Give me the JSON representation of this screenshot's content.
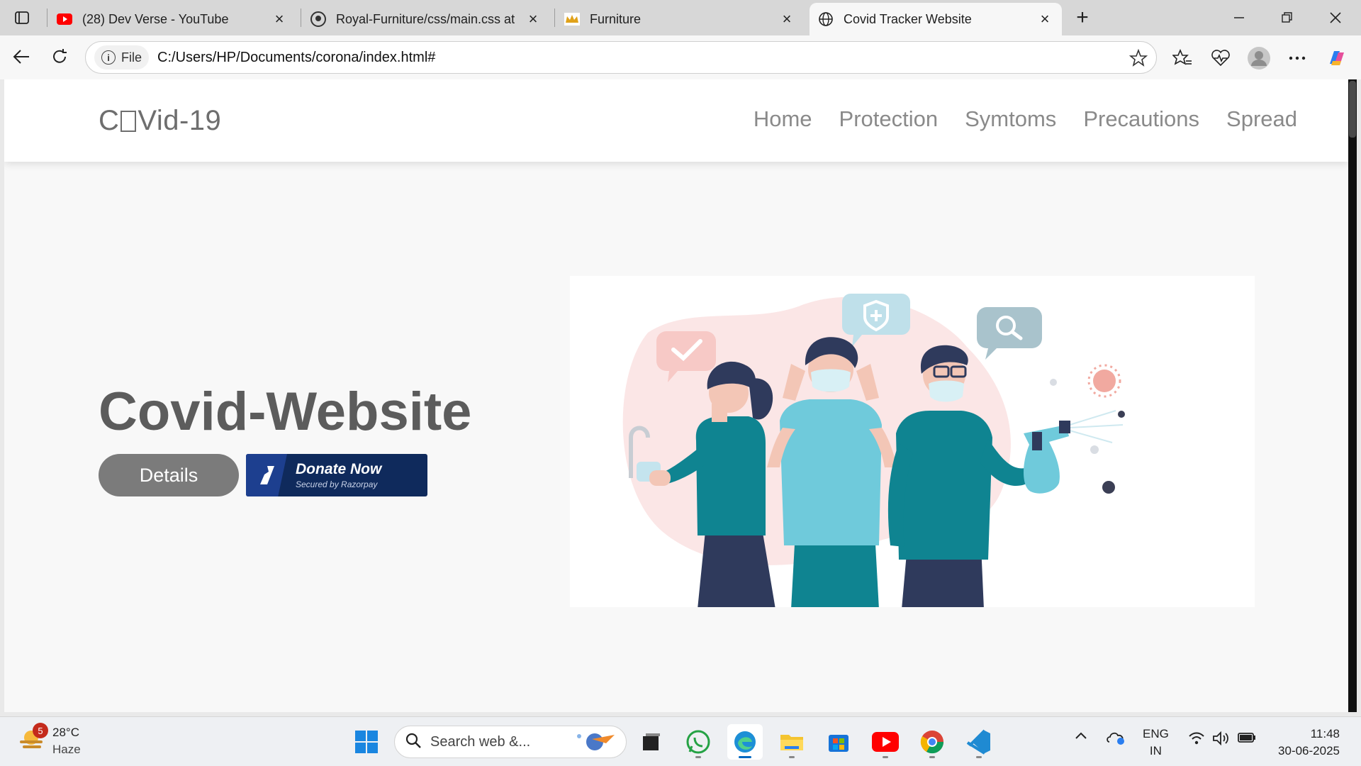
{
  "browser": {
    "tabs": [
      {
        "label": "(28) Dev Verse - YouTube",
        "favicon": "youtube-icon"
      },
      {
        "label": "Royal-Furniture/css/main.css at m",
        "favicon": "github-icon"
      },
      {
        "label": "Furniture",
        "favicon": "crown-icon"
      },
      {
        "label": "Covid Tracker Website",
        "favicon": "globe-icon"
      }
    ],
    "address": {
      "chip_label": "File",
      "url": "C:/Users/HP/Documents/corona/index.html#"
    }
  },
  "page": {
    "logo": {
      "before": "C",
      "after": "Vid-19"
    },
    "nav": [
      "Home",
      "Protection",
      "Symtoms",
      "Precautions",
      "Spread"
    ],
    "hero": {
      "title": "Covid-Website",
      "details_label": "Details",
      "donate_label": "Donate Now",
      "donate_sub": "Secured by Razorpay"
    }
  },
  "taskbar": {
    "weather": {
      "temp": "28°C",
      "condition": "Haze",
      "badge": "5"
    },
    "search_placeholder": "Search web &...",
    "language": {
      "line1": "ENG",
      "line2": "IN"
    },
    "clock": {
      "time": "11:48",
      "date": "30-06-2025"
    }
  },
  "colors": {
    "teal": "#0f8491",
    "light_blue": "#6fcadb",
    "navy": "#2d3a5c",
    "donate_blue": "#0f2a5c"
  }
}
